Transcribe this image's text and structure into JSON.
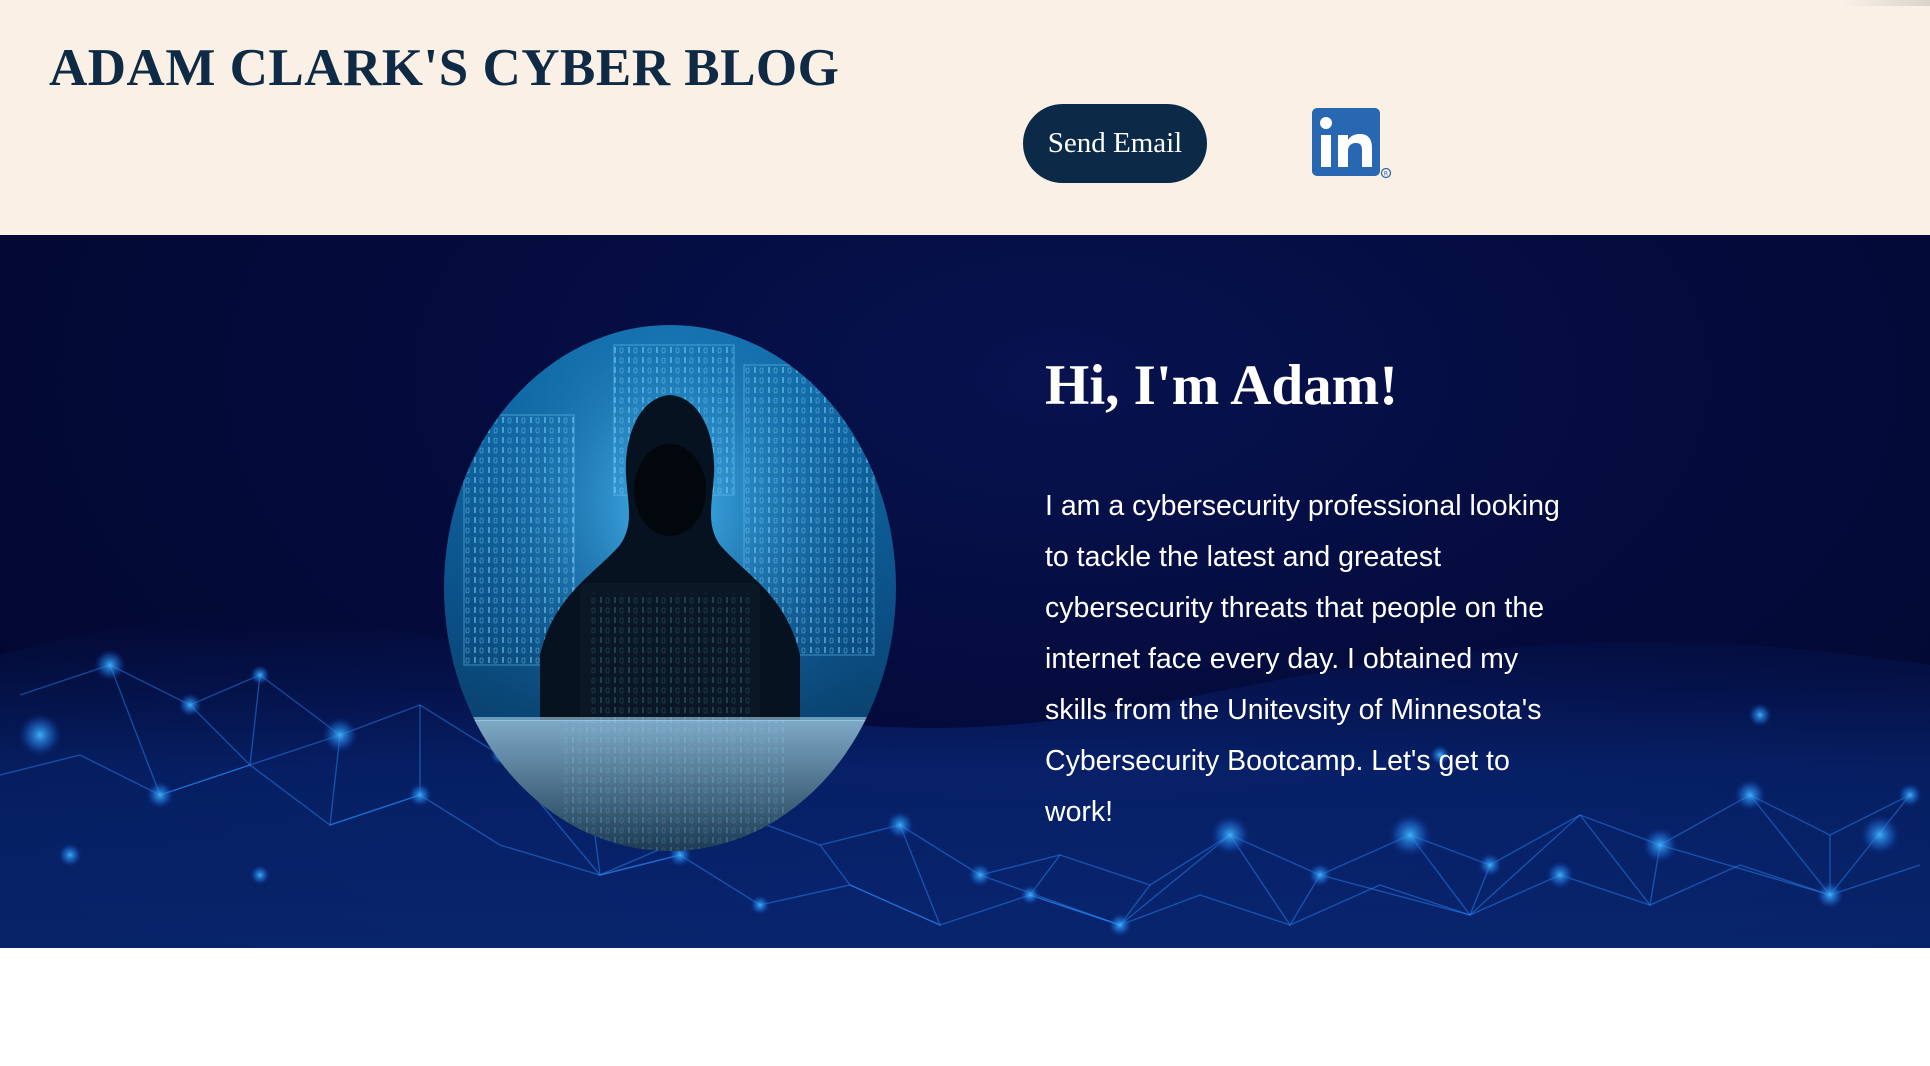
{
  "header": {
    "site_title": "ADAM CLARK'S CYBER BLOG",
    "send_email_label": "Send Email",
    "linkedin_icon": "linkedin-icon",
    "bg_color": "#faf0e6",
    "title_color": "#0f2a45",
    "button_color": "#0b2a47",
    "linkedin_color": "#2867b2"
  },
  "hero": {
    "greeting": "Hi, I'm Adam!",
    "bio": "I am a cybersecurity professional looking to tackle the latest and greatest cybersecurity threats that people on the internet face every day. I obtained my skills from the Unitevsity of Minnesota's Cybersecurity Bootcamp. Let's get to work!",
    "avatar": "hooded-hacker-image",
    "background": "network-mesh-image",
    "bg_color": "#040b3c"
  }
}
